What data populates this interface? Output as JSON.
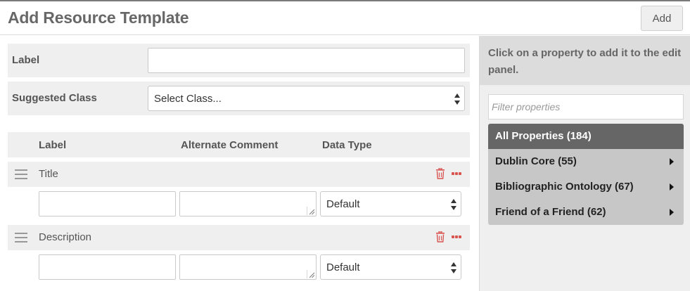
{
  "header": {
    "title": "Add Resource Template",
    "add_label": "Add"
  },
  "form": {
    "label_field": {
      "label": "Label",
      "value": ""
    },
    "class_field": {
      "label": "Suggested Class",
      "selected": "Select Class..."
    }
  },
  "table": {
    "columns": [
      "Label",
      "Alternate Comment",
      "Data Type"
    ],
    "rows": [
      {
        "title": "Title",
        "alt_label": "",
        "alt_comment": "",
        "data_type": "Default"
      },
      {
        "title": "Description",
        "alt_label": "",
        "alt_comment": "",
        "data_type": "Default"
      }
    ]
  },
  "sidebar": {
    "intro": "Click on a property to add it to the edit panel.",
    "filter_placeholder": "Filter properties",
    "groups": [
      {
        "label": "All Properties (184)",
        "active": true
      },
      {
        "label": "Dublin Core (55)",
        "active": false
      },
      {
        "label": "Bibliographic Ontology (67)",
        "active": false
      },
      {
        "label": "Friend of a Friend (62)",
        "active": false
      }
    ]
  },
  "icons": {
    "drag": "drag-handle-icon",
    "delete": "trash-icon",
    "more": "ellipsis-icon",
    "expand": "triangle-right-icon",
    "select": "updown-arrows-icon"
  },
  "colors": {
    "danger": "#d9534f",
    "active_group": "#666666",
    "group": "#c7c7c7",
    "panel": "#efefef"
  }
}
